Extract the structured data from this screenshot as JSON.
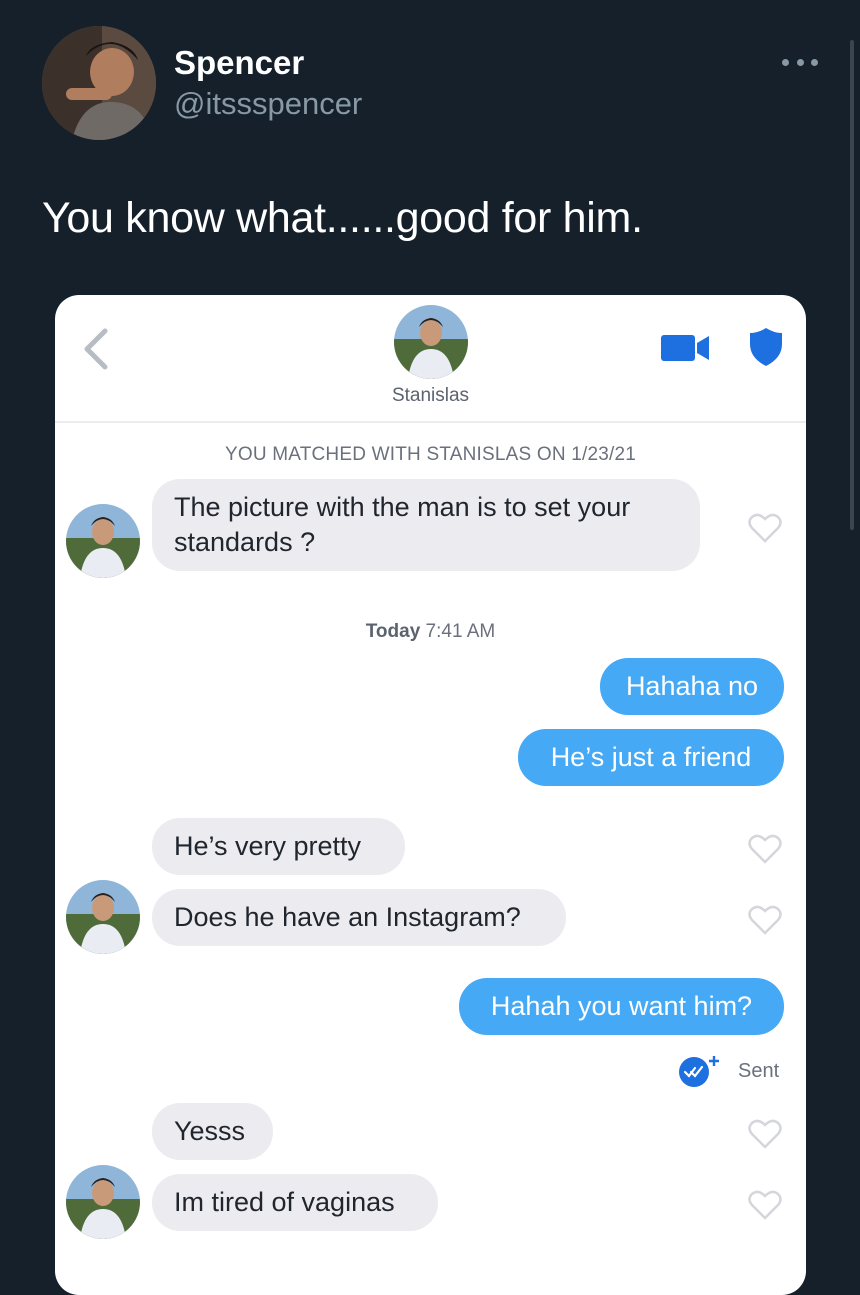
{
  "tweet": {
    "author_name": "Spencer",
    "author_handle": "@itssspencer",
    "text": "You know what......good for him."
  },
  "chat": {
    "match_name": "Stanislas",
    "matched_banner": "YOU MATCHED WITH STANISLAS ON 1/23/21",
    "timestamp_day": "Today",
    "timestamp_time": "7:41 AM",
    "messages": [
      {
        "from": "them",
        "text": "The picture with the man is to set your standards ?"
      },
      {
        "from": "me",
        "text": "Hahaha no"
      },
      {
        "from": "me",
        "text": "He’s just a friend"
      },
      {
        "from": "them",
        "text": "He’s very pretty"
      },
      {
        "from": "them",
        "text": "Does he have an Instagram?"
      },
      {
        "from": "me",
        "text": "Hahah you want him?"
      },
      {
        "from": "them",
        "text": "Yesss"
      },
      {
        "from": "them",
        "text": "Im tired of vaginas"
      }
    ],
    "sent_status": "Sent"
  },
  "colors": {
    "background": "#15202b",
    "outgoing_bubble": "#45a9f5",
    "incoming_bubble": "#ececf0",
    "accent_icon": "#1e6fe0"
  },
  "icons": [
    "more-icon",
    "back-icon",
    "video-call-icon",
    "shield-icon",
    "heart-icon",
    "read-receipt-icon"
  ]
}
